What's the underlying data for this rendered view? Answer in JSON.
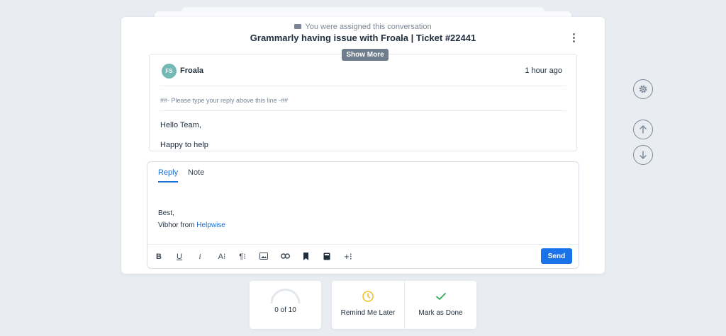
{
  "header": {
    "assigned_text": "You were assigned this conversation",
    "title": "Grammarly having issue with Froala | Ticket #22441",
    "kebab": "⋮"
  },
  "thread": {
    "show_more_label": "Show More",
    "message": {
      "avatar_initials": "FS",
      "sender": "Froala",
      "time": "1 hour ago",
      "reply_marker": "##- Please type your reply above this line -##",
      "body_lines": [
        "Hello Team,",
        "Happy to help"
      ]
    }
  },
  "editor": {
    "tabs": [
      {
        "label": "Reply",
        "active": true
      },
      {
        "label": "Note",
        "active": false
      }
    ],
    "signature": {
      "line1": "Best,",
      "line2_prefix": "Vibhor from ",
      "line2_link": "Helpwise"
    },
    "toolbar": [
      {
        "name": "bold-icon",
        "glyph": "B"
      },
      {
        "name": "underline-icon",
        "glyph": "U"
      },
      {
        "name": "italic-icon",
        "glyph": "i"
      },
      {
        "name": "font-size-icon",
        "glyph": "A⁝"
      },
      {
        "name": "paragraph-icon",
        "glyph": "¶⁝"
      },
      {
        "name": "image-icon",
        "glyph": ""
      },
      {
        "name": "link-icon",
        "glyph": ""
      },
      {
        "name": "bookmark-icon",
        "glyph": ""
      },
      {
        "name": "book-icon",
        "glyph": ""
      },
      {
        "name": "more-insert-icon",
        "glyph": "+⁝"
      }
    ],
    "send_label": "Send"
  },
  "side_controls": [
    "gear-icon",
    "arrow-up-icon",
    "arrow-down-icon"
  ],
  "progress": {
    "text": "0 of 10",
    "fraction": 0
  },
  "actions": {
    "remind_label": "Remind Me Later",
    "done_label": "Mark as Done"
  },
  "colors": {
    "accent": "#1a73e8",
    "avatar": "#72b8b4",
    "clock": "#f2c12e",
    "check": "#2eaa5c",
    "background": "#e9edf2"
  }
}
